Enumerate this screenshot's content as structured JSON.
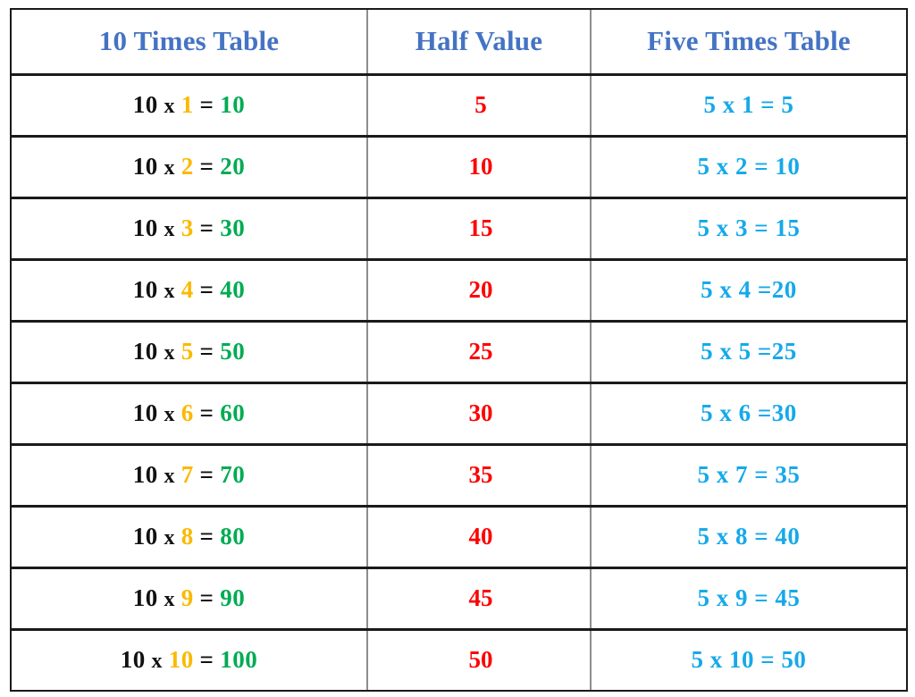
{
  "table": {
    "headers": [
      {
        "id": "ten-times-table",
        "label": "10 Times Table"
      },
      {
        "id": "half-value",
        "label": "Half Value"
      },
      {
        "id": "five-times-table",
        "label": "Five Times Table"
      }
    ],
    "colors": {
      "header_blue": "#4573c4",
      "black": "#111111",
      "amber": "#fbb900",
      "green": "#00ab53",
      "red": "#fe0000",
      "sky_blue": "#15a9ea",
      "rule_dark": "#1a1a1a",
      "rule_gray": "#8d8d8d",
      "background": "#ffffff"
    },
    "rows": [
      {
        "ten": {
          "operand_a": "10",
          "times": "x",
          "operand_b": "1",
          "equals": "=",
          "product": "10",
          "text": "10 x 1 = 10"
        },
        "half": "5",
        "five": "5 x 1 = 5"
      },
      {
        "ten": {
          "operand_a": "10",
          "times": "x",
          "operand_b": "2",
          "equals": "=",
          "product": "20",
          "text": "10 x 2 = 20"
        },
        "half": "10",
        "five": "5 x 2 = 10"
      },
      {
        "ten": {
          "operand_a": "10",
          "times": "x",
          "operand_b": "3",
          "equals": "=",
          "product": "30",
          "text": "10 x 3 = 30"
        },
        "half": "15",
        "five": "5 x 3 = 15"
      },
      {
        "ten": {
          "operand_a": "10",
          "times": "x",
          "operand_b": "4",
          "equals": "=",
          "product": "40",
          "text": "10 x 4 = 40"
        },
        "half": "20",
        "five": "5 x 4 =20"
      },
      {
        "ten": {
          "operand_a": "10",
          "times": "x",
          "operand_b": "5",
          "equals": "=",
          "product": "50",
          "text": "10 x 5 = 50"
        },
        "half": "25",
        "five": "5 x 5 =25"
      },
      {
        "ten": {
          "operand_a": "10",
          "times": "x",
          "operand_b": "6",
          "equals": "=",
          "product": "60",
          "text": "10 x 6 = 60"
        },
        "half": "30",
        "five": "5 x 6 =30"
      },
      {
        "ten": {
          "operand_a": "10",
          "times": "x",
          "operand_b": "7",
          "equals": "=",
          "product": "70",
          "text": "10 x 7 = 70"
        },
        "half": "35",
        "five": "5 x 7 = 35"
      },
      {
        "ten": {
          "operand_a": "10",
          "times": "x",
          "operand_b": "8",
          "equals": "=",
          "product": "80",
          "text": "10 x 8 = 80"
        },
        "half": "40",
        "five": "5 x 8 = 40"
      },
      {
        "ten": {
          "operand_a": "10",
          "times": "x",
          "operand_b": "9",
          "equals": "=",
          "product": "90",
          "text": "10 x 9 = 90"
        },
        "half": "45",
        "five": "5 x 9 = 45"
      },
      {
        "ten": {
          "operand_a": "10",
          "times": "x",
          "operand_b": "10",
          "equals": "=",
          "product": "100",
          "text": "10 x 10 = 100"
        },
        "half": "50",
        "five": "5 x 10 = 50"
      }
    ]
  },
  "chart_data": {
    "type": "table",
    "title": "10 Times Table / Half Value / Five Times Table",
    "columns": [
      "10 Times Table",
      "Half Value",
      "Five Times Table"
    ],
    "multiplier_ten": 10,
    "multiplier_five": 5,
    "factors": [
      1,
      2,
      3,
      4,
      5,
      6,
      7,
      8,
      9,
      10
    ],
    "series": [
      {
        "name": "10 Times Table",
        "values": [
          10,
          20,
          30,
          40,
          50,
          60,
          70,
          80,
          90,
          100
        ]
      },
      {
        "name": "Half Value",
        "values": [
          5,
          10,
          15,
          20,
          25,
          30,
          35,
          40,
          45,
          50
        ]
      },
      {
        "name": "Five Times Table",
        "values": [
          5,
          10,
          15,
          20,
          25,
          30,
          35,
          40,
          45,
          50
        ]
      }
    ],
    "rows": [
      [
        "10 x 1 = 10",
        "5",
        "5 x 1 = 5"
      ],
      [
        "10 x 2 = 20",
        "10",
        "5 x 2 = 10"
      ],
      [
        "10 x 3 = 30",
        "15",
        "5 x 3 = 15"
      ],
      [
        "10 x 4 = 40",
        "20",
        "5 x 4 =20"
      ],
      [
        "10 x 5 = 50",
        "25",
        "5 x 5 =25"
      ],
      [
        "10 x 6 = 60",
        "30",
        "5 x 6 =30"
      ],
      [
        "10 x 7 = 70",
        "35",
        "5 x 7 = 35"
      ],
      [
        "10 x 8 = 80",
        "40",
        "5 x 8 = 40"
      ],
      [
        "10 x 9 = 90",
        "45",
        "5 x 9 = 45"
      ],
      [
        "10 x 10 = 100",
        "50",
        "5 x 10 = 50"
      ]
    ]
  }
}
